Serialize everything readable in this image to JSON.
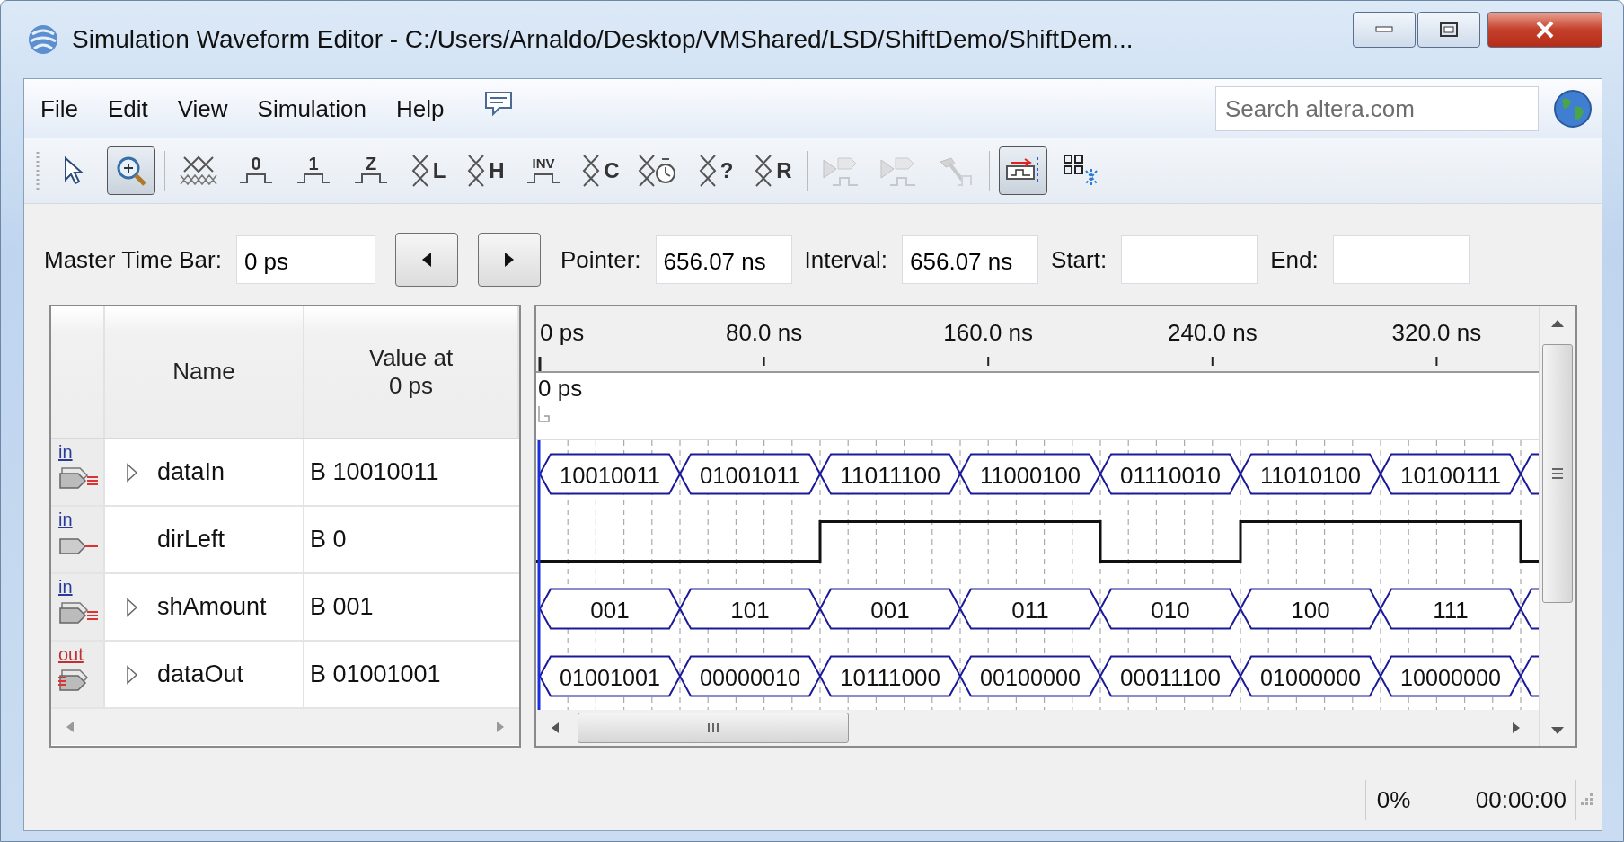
{
  "window": {
    "title": "Simulation Waveform Editor - C:/Users/Arnaldo/Desktop/VMShared/LSD/ShiftDemo/ShiftDem..."
  },
  "menu": [
    "File",
    "Edit",
    "View",
    "Simulation",
    "Help"
  ],
  "search": {
    "placeholder": "Search altera.com"
  },
  "toolbar": [
    {
      "kind": "pointer",
      "selected": false,
      "disabled": false
    },
    {
      "kind": "zoom",
      "selected": true,
      "disabled": false
    },
    {
      "kind": "unknown",
      "selected": false,
      "disabled": false
    },
    {
      "kind": "level",
      "glyph": "0",
      "selected": false,
      "disabled": false
    },
    {
      "kind": "level",
      "glyph": "1",
      "selected": false,
      "disabled": false
    },
    {
      "kind": "level",
      "glyph": "Z",
      "selected": false,
      "disabled": false
    },
    {
      "kind": "bus",
      "glyph": "L",
      "selected": false,
      "disabled": false
    },
    {
      "kind": "bus",
      "glyph": "H",
      "selected": false,
      "disabled": false
    },
    {
      "kind": "level",
      "glyph": "INV",
      "selected": false,
      "disabled": false
    },
    {
      "kind": "bus",
      "glyph": "C",
      "selected": false,
      "disabled": false
    },
    {
      "kind": "clock",
      "selected": false,
      "disabled": false
    },
    {
      "kind": "bus",
      "glyph": "?",
      "selected": false,
      "disabled": false
    },
    {
      "kind": "bus",
      "glyph": "R",
      "selected": false,
      "disabled": false
    },
    {
      "kind": "simulate",
      "selected": false,
      "disabled": true
    },
    {
      "kind": "simulate",
      "selected": false,
      "disabled": true
    },
    {
      "kind": "hammer",
      "selected": false,
      "disabled": true
    },
    {
      "kind": "snap",
      "selected": true,
      "disabled": false
    },
    {
      "kind": "grid",
      "selected": false,
      "disabled": false
    }
  ],
  "time_bar": {
    "label": "Master Time Bar:",
    "value": "0 ps",
    "fields": [
      {
        "label": "Pointer:",
        "value": "656.07 ns"
      },
      {
        "label": "Interval:",
        "value": "656.07 ns"
      },
      {
        "label": "Start:"
      },
      {
        "label": "End:"
      }
    ]
  },
  "signals": {
    "columns": [
      {
        "lines": [
          "Name"
        ]
      },
      {
        "lines": [
          "Value at",
          "0 ps"
        ]
      }
    ],
    "rows": [
      {
        "pin": "in",
        "kind": "bus-in",
        "expanded": false,
        "name": "dataIn",
        "value": "B 10010011",
        "segments": [
          "10010011",
          "01001011",
          "11011100",
          "11000100",
          "01110010",
          "11010100",
          "10100111"
        ]
      },
      {
        "pin": "in",
        "kind": "bit-in",
        "name": "dirLeft",
        "value": "B 0",
        "high": [
          false,
          false,
          true,
          true,
          false,
          true,
          true,
          false
        ]
      },
      {
        "pin": "in",
        "kind": "bus-in",
        "expanded": false,
        "name": "shAmount",
        "value": "B 001",
        "segments": [
          "001",
          "101",
          "001",
          "011",
          "010",
          "100",
          "111"
        ]
      },
      {
        "pin": "out",
        "kind": "bus-out",
        "expanded": false,
        "name": "dataOut",
        "value": "B 01001001",
        "segments": [
          "01001001",
          "00000010",
          "10111000",
          "00100000",
          "00011100",
          "01000000",
          "10000000"
        ]
      }
    ]
  },
  "ruler": {
    "ticks": [
      "0 ps",
      "80.0 ns",
      "160.0 ns",
      "240.0 ns",
      "320.0 ns"
    ],
    "marker": "0 ps"
  },
  "status": {
    "progress": "0%",
    "elapsed": "00:00:00"
  }
}
